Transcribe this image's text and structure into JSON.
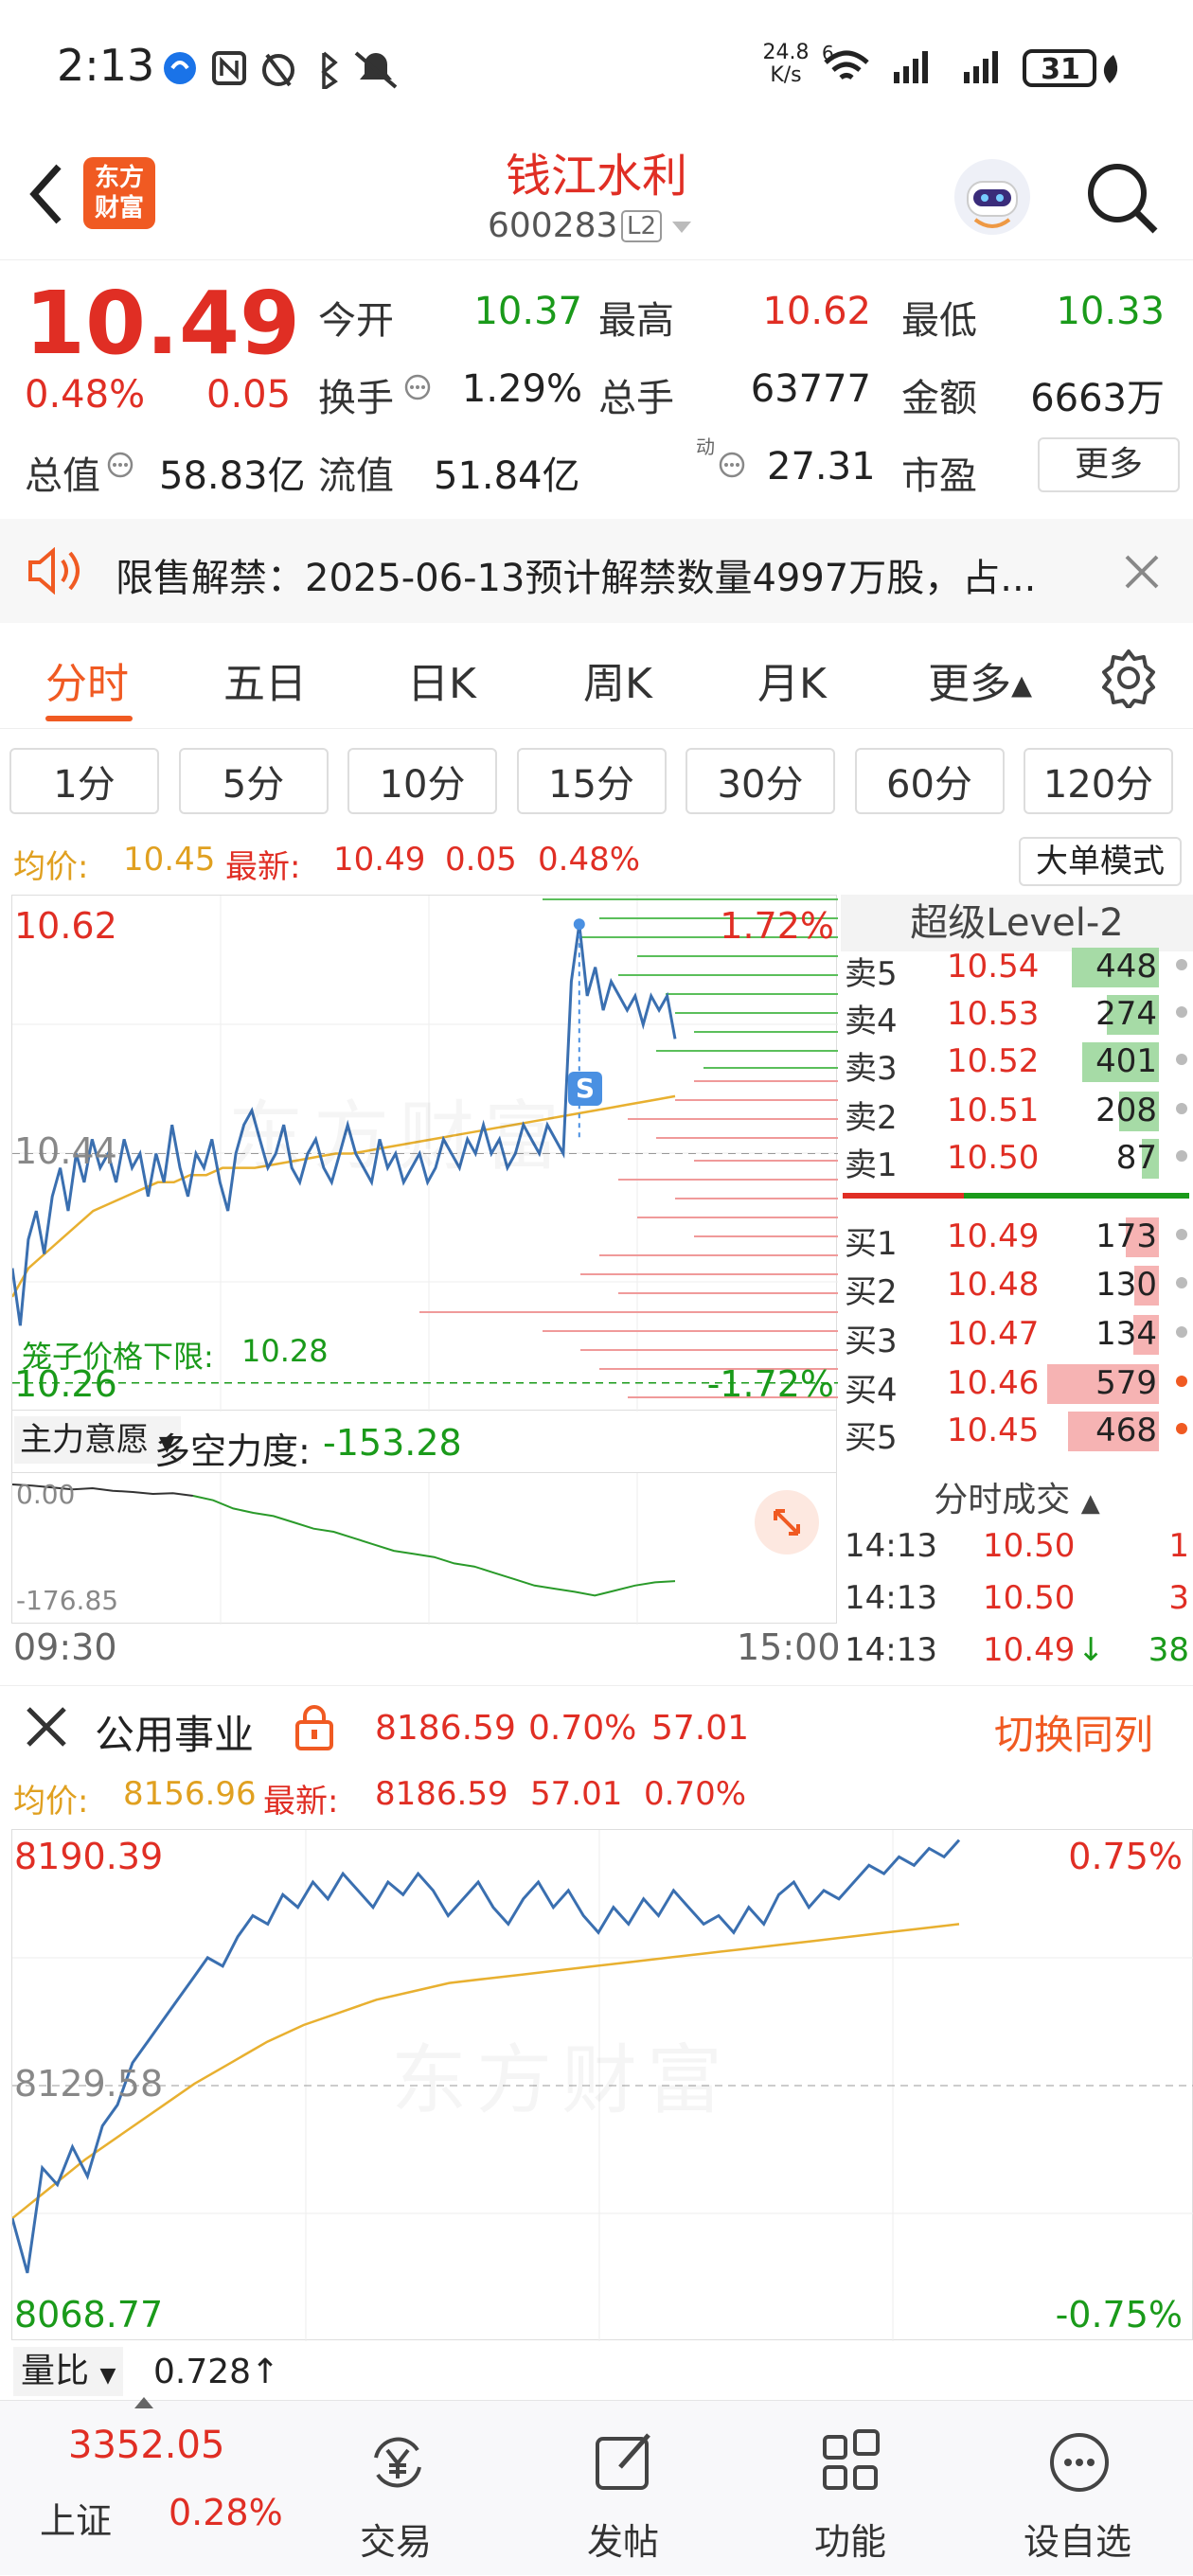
{
  "status": {
    "time": "2:13",
    "net_speed": "24.8",
    "net_unit": "K/s",
    "sig_badge": "6",
    "battery": "31"
  },
  "header": {
    "logo_line1": "东方",
    "logo_line2": "财富",
    "name": "钱江水利",
    "code": "600283",
    "level": "L2"
  },
  "quote": {
    "price": "10.49",
    "change_pct": "0.48%",
    "change": "0.05",
    "fields": [
      {
        "label": "今开",
        "value": "10.37"
      },
      {
        "label": "最高",
        "value": "10.62"
      },
      {
        "label": "最低",
        "value": "10.33"
      },
      {
        "label": "换手",
        "value": "1.29%"
      },
      {
        "label": "总手",
        "value": "63777"
      },
      {
        "label": "金额",
        "value": "6663万"
      },
      {
        "label": "总值",
        "value": "58.83亿"
      },
      {
        "label": "流值",
        "value": "51.84亿"
      },
      {
        "label": "市盈",
        "value": "27.31",
        "sup": "动"
      }
    ],
    "more_label": "更多"
  },
  "notice": {
    "text": "限售解禁：2025-06-13预计解禁数量4997万股，占..."
  },
  "tabs": [
    "分时",
    "五日",
    "日K",
    "周K",
    "月K",
    "更多▴"
  ],
  "periods": [
    "1分",
    "5分",
    "10分",
    "15分",
    "30分",
    "60分",
    "120分"
  ],
  "summary": {
    "avg_label": "均价:",
    "avg": "10.45",
    "latest_label": "最新:",
    "latest": "10.49",
    "change": "0.05",
    "pct": "0.48%",
    "mode_btn": "大单模式"
  },
  "chart1": {
    "ymax": "10.62",
    "ymid": "10.44",
    "ymin": "10.26",
    "pct_top": "1.72%",
    "pct_bot": "-1.72%",
    "cage_label": "笼子价格下限:",
    "cage_value": "10.28",
    "marker": "S",
    "watermark": "东方财富",
    "price_series": [
      10.36,
      10.32,
      10.38,
      10.4,
      10.37,
      10.41,
      10.43,
      10.4,
      10.44,
      10.42,
      10.45,
      10.43,
      10.44,
      10.42,
      10.45,
      10.43,
      10.44,
      10.41,
      10.44,
      10.42,
      10.46,
      10.43,
      10.41,
      10.44,
      10.43,
      10.45,
      10.42,
      10.4,
      10.44,
      10.46,
      10.47,
      10.45,
      10.43,
      10.44,
      10.46,
      10.43,
      10.42,
      10.44,
      10.45,
      10.43,
      10.42,
      10.44,
      10.46,
      10.44,
      10.43,
      10.42,
      10.45,
      10.43,
      10.44,
      10.42,
      10.43,
      10.44,
      10.42,
      10.43,
      10.45,
      10.44,
      10.43,
      10.45,
      10.44,
      10.46,
      10.44,
      10.45,
      10.43,
      10.44,
      10.46,
      10.45,
      10.44,
      10.46,
      10.45,
      10.44,
      10.56,
      10.6,
      10.55,
      10.57,
      10.54,
      10.56,
      10.55,
      10.54,
      10.55,
      10.53,
      10.55,
      10.54,
      10.55,
      10.52
    ],
    "avg_series": [
      10.34,
      10.36,
      10.37,
      10.38,
      10.39,
      10.4,
      10.405,
      10.41,
      10.415,
      10.42,
      10.42,
      10.425,
      10.425,
      10.43,
      10.43,
      10.43,
      10.432,
      10.434,
      10.436,
      10.438,
      10.44,
      10.44,
      10.442,
      10.444,
      10.446,
      10.448,
      10.45,
      10.452,
      10.454,
      10.456,
      10.458,
      10.46,
      10.462,
      10.464,
      10.466,
      10.468,
      10.47,
      10.472,
      10.474,
      10.476,
      10.478,
      10.48
    ]
  },
  "level2": {
    "title": "超级Level-2",
    "asks": [
      {
        "label": "卖5",
        "price": "10.54",
        "vol": "448",
        "frac": 0.78
      },
      {
        "label": "卖4",
        "price": "10.53",
        "vol": "274",
        "frac": 0.47
      },
      {
        "label": "卖3",
        "price": "10.52",
        "vol": "401",
        "frac": 0.69
      },
      {
        "label": "卖2",
        "price": "10.51",
        "vol": "208",
        "frac": 0.36
      },
      {
        "label": "卖1",
        "price": "10.50",
        "vol": "87",
        "frac": 0.15
      }
    ],
    "bids": [
      {
        "label": "买1",
        "price": "10.49",
        "vol": "173",
        "frac": 0.3
      },
      {
        "label": "买2",
        "price": "10.48",
        "vol": "130",
        "frac": 0.22
      },
      {
        "label": "买3",
        "price": "10.47",
        "vol": "134",
        "frac": 0.23
      },
      {
        "label": "买4",
        "price": "10.46",
        "vol": "579",
        "frac": 1.0
      },
      {
        "label": "买5",
        "price": "10.45",
        "vol": "468",
        "frac": 0.81
      }
    ],
    "ticks_title": "分时成交",
    "ticks": [
      {
        "time": "14:13",
        "price": "10.50",
        "vol": "1",
        "arrow": ""
      },
      {
        "time": "14:13",
        "price": "10.50",
        "vol": "3",
        "arrow": ""
      },
      {
        "time": "14:13",
        "price": "10.49",
        "vol": "38",
        "arrow": "↓"
      }
    ]
  },
  "indicator": {
    "name": "主力意愿",
    "label": "多空力度:",
    "value": "-153.28",
    "top": "0.00",
    "bottom": "-176.85",
    "start": "09:30",
    "end": "15:00"
  },
  "sector": {
    "name": "公用事业",
    "value": "8186.59",
    "pct": "0.70%",
    "change": "57.01",
    "switch": "切换同列"
  },
  "summary2": {
    "avg_label": "均价:",
    "avg": "8156.96",
    "latest_label": "最新:",
    "latest": "8186.59",
    "change": "57.01",
    "pct": "0.70%"
  },
  "chart3": {
    "ymax": "8190.39",
    "ymid": "8129.58",
    "ymin": "8068.77",
    "pct_top": "0.75%",
    "pct_bot": "-0.75%",
    "watermark": "东方财富"
  },
  "volratio": {
    "label": "量比",
    "value": "0.728↑"
  },
  "bottomnav": {
    "index_value": "3352.05",
    "index_name": "上证",
    "index_pct": "0.28%",
    "items": [
      {
        "label": "交易",
        "icon": "trade-icon"
      },
      {
        "label": "发帖",
        "icon": "post-icon"
      },
      {
        "label": "功能",
        "icon": "apps-icon"
      },
      {
        "label": "设自选",
        "icon": "favorite-icon"
      }
    ]
  }
}
